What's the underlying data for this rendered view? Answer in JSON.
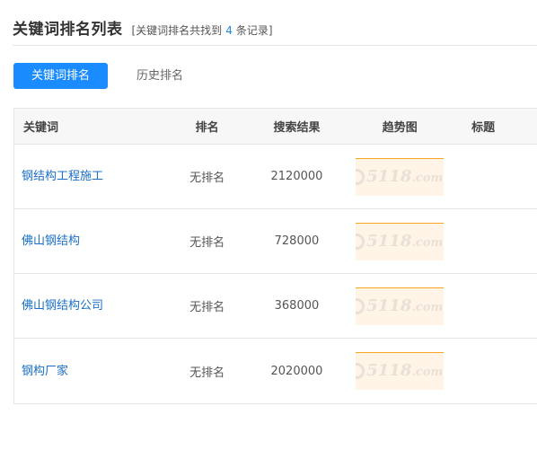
{
  "header": {
    "title": "关键词排名列表",
    "subtitle_prefix": "[关键词排名共找到",
    "record_count": "4",
    "subtitle_suffix": "条记录]"
  },
  "tabs": [
    {
      "label": "关键词排名",
      "active": true
    },
    {
      "label": "历史排名",
      "active": false
    }
  ],
  "table": {
    "columns": [
      "关键词",
      "排名",
      "搜索结果",
      "趋势图",
      "标题"
    ],
    "rows": [
      {
        "keyword": "钢结构工程施工",
        "rank": "无排名",
        "results": "2120000",
        "title": ""
      },
      {
        "keyword": "佛山钢结构",
        "rank": "无排名",
        "results": "728000",
        "title": ""
      },
      {
        "keyword": "佛山钢结构公司",
        "rank": "无排名",
        "results": "368000",
        "title": ""
      },
      {
        "keyword": "钢构厂家",
        "rank": "无排名",
        "results": "2020000",
        "title": ""
      }
    ]
  },
  "watermark": {
    "brand": "5118",
    "suffix": ".com"
  },
  "colors": {
    "accent": "#1a8cff",
    "link": "#1a6fc4",
    "trend_bg": "#fff4e6",
    "trend_line": "#f5a623"
  }
}
